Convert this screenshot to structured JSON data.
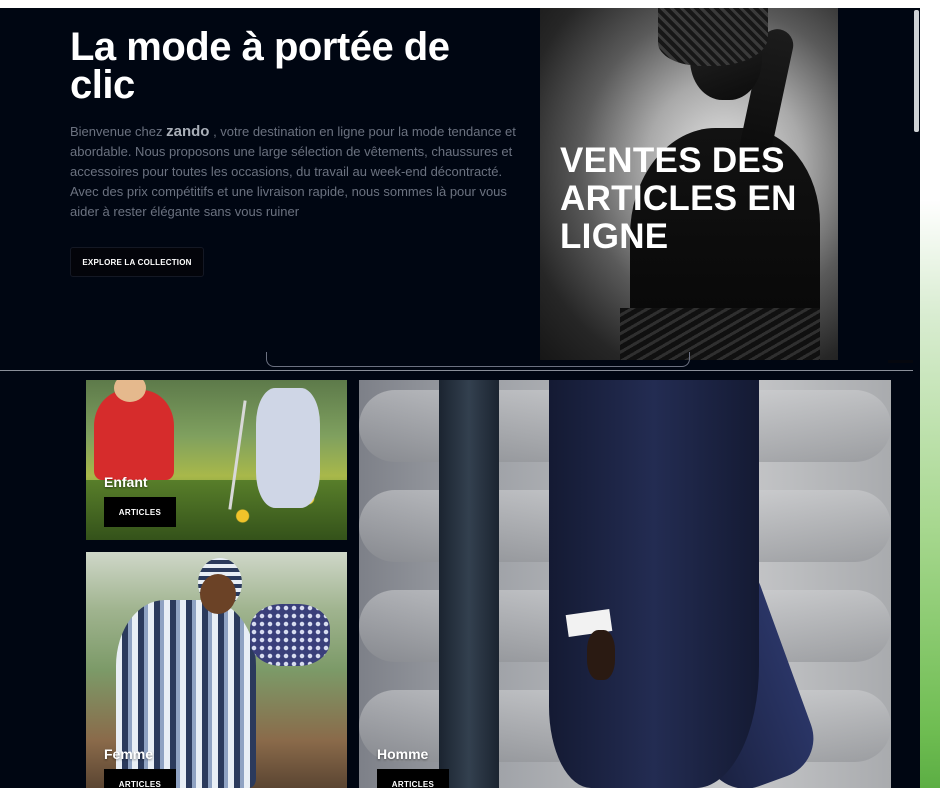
{
  "hero": {
    "title": "La mode à portée de clic",
    "description_before": "Bienvenue chez ",
    "brand": "zando",
    "description_after": " , votre destination en ligne pour la mode tendance et abordable. Nous proposons une large sélection de vêtements, chaussures et accessoires pour toutes les occasions, du travail au week-end décontracté. Avec des prix compétitifs et une livraison rapide, nous sommes là pour vous aider à rester élégante sans vous ruiner",
    "cta_label": "EXPLORE LA COLLECTION",
    "photo_caption": "VENTES DES ARTICLES EN LIGNE"
  },
  "categories": [
    {
      "name": "Enfant",
      "button_label": "ARTICLES"
    },
    {
      "name": "Femme",
      "button_label": "ARTICLES"
    },
    {
      "name": "Homme",
      "button_label": "ARTICLES"
    }
  ],
  "colors": {
    "background": "#000612",
    "accent_green": "#6fbd52",
    "button": "#000000",
    "text_primary": "#ffffff",
    "text_muted": "#6b7280"
  }
}
